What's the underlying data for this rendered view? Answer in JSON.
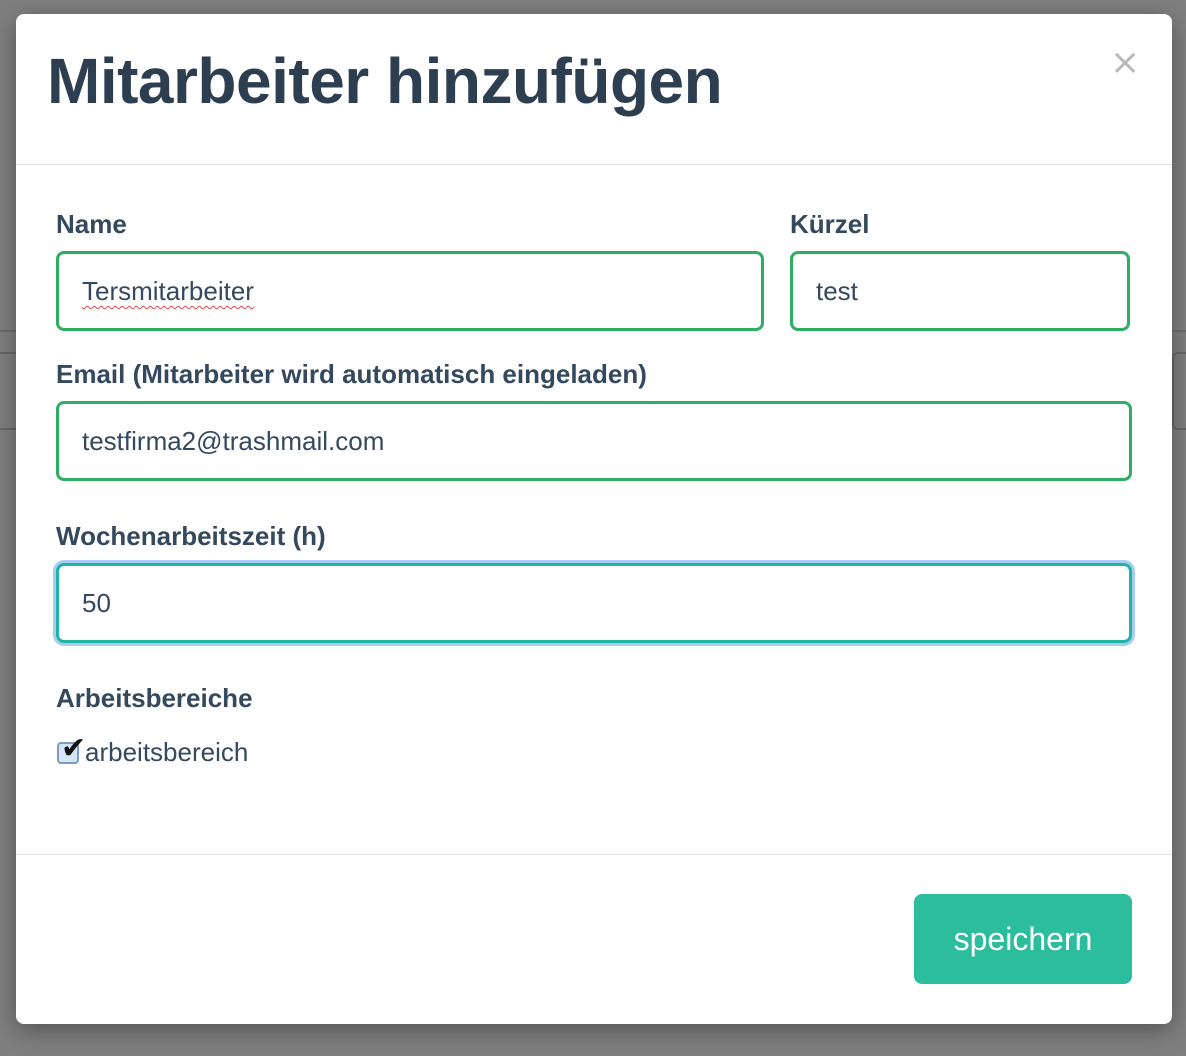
{
  "modal": {
    "title": "Mitarbeiter hinzufügen",
    "close_symbol": "×",
    "close_icon": "close-icon"
  },
  "form": {
    "name": {
      "label": "Name",
      "value": "Tersmitarbeiter"
    },
    "kuerzel": {
      "label": "Kürzel",
      "value": "test"
    },
    "email": {
      "label": "Email (Mitarbeiter wird automatisch eingeladen)",
      "value": "testfirma2@trashmail.com"
    },
    "hours": {
      "label": "Wochenarbeitszeit (h)",
      "value": "50"
    },
    "areas": {
      "label": "Arbeitsbereiche",
      "items": [
        {
          "label": "arbeitsbereich",
          "checked": true
        }
      ]
    }
  },
  "footer": {
    "save_label": "speichern"
  },
  "colors": {
    "valid_border": "#2fae63",
    "focus_border": "#1fb5a0",
    "primary_button": "#2bbd9c",
    "heading_text": "#2c3e50"
  }
}
